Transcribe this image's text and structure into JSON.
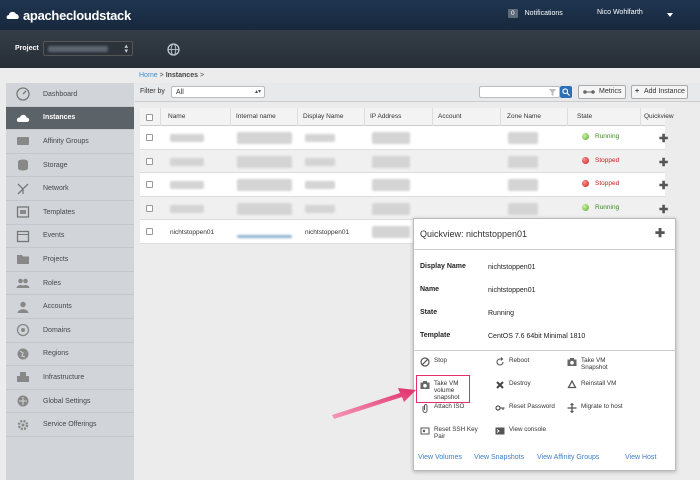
{
  "app": {
    "name": "apachecloudstack"
  },
  "header": {
    "notifications_count": "0",
    "notifications_label": "Notifications",
    "user_name": "Nico Wohlfarth"
  },
  "project": {
    "label": "Project"
  },
  "sidebar": {
    "items": [
      {
        "label": "Dashboard",
        "icon": "dashboard-icon"
      },
      {
        "label": "Instances",
        "icon": "cloud-icon"
      },
      {
        "label": "Affinity Groups",
        "icon": "affinity-icon"
      },
      {
        "label": "Storage",
        "icon": "storage-icon"
      },
      {
        "label": "Network",
        "icon": "network-icon"
      },
      {
        "label": "Templates",
        "icon": "templates-icon"
      },
      {
        "label": "Events",
        "icon": "events-icon"
      },
      {
        "label": "Projects",
        "icon": "folder-icon"
      },
      {
        "label": "Roles",
        "icon": "roles-icon"
      },
      {
        "label": "Accounts",
        "icon": "accounts-icon"
      },
      {
        "label": "Domains",
        "icon": "domains-icon"
      },
      {
        "label": "Regions",
        "icon": "globe-icon"
      },
      {
        "label": "Infrastructure",
        "icon": "infrastructure-icon"
      },
      {
        "label": "Global Settings",
        "icon": "settings-icon"
      },
      {
        "label": "Service Offerings",
        "icon": "gear-icon"
      }
    ],
    "active": "Instances"
  },
  "breadcrumb": {
    "home": "Home",
    "sep": ">",
    "current": "Instances"
  },
  "toolbar": {
    "filter_label": "Filter by",
    "filter_value": "All",
    "metrics_label": "Metrics",
    "add_label": "Add Instance"
  },
  "table": {
    "columns": [
      "Name",
      "Internal name",
      "Display Name",
      "IP Address",
      "Account",
      "Zone Name",
      "State",
      "Quickview"
    ],
    "rows": [
      {
        "state": "Running",
        "status": "green"
      },
      {
        "state": "Stopped",
        "status": "red"
      },
      {
        "state": "Stopped",
        "status": "red"
      },
      {
        "state": "Running",
        "status": "green"
      },
      {
        "name": "nichtstoppen01",
        "display_name": "nichtstoppen01"
      }
    ]
  },
  "quickview": {
    "title": "Quickview: nichtstoppen01",
    "fields": [
      {
        "label": "Display Name",
        "value": "nichtstoppen01"
      },
      {
        "label": "Name",
        "value": "nichtstoppen01"
      },
      {
        "label": "State",
        "value": "Running"
      },
      {
        "label": "Template",
        "value": "CentOS 7.6 64bit Minimal 1810"
      }
    ],
    "actions": [
      {
        "label": "Stop",
        "icon": "stop-icon"
      },
      {
        "label": "Reboot",
        "icon": "reboot-icon"
      },
      {
        "label": "Take VM Snapshot",
        "icon": "camera-icon"
      },
      {
        "label": "Take VM volume snapshot",
        "icon": "camera-icon"
      },
      {
        "label": "Destroy",
        "icon": "destroy-icon"
      },
      {
        "label": "Reinstall VM",
        "icon": "recycle-icon"
      },
      {
        "label": "Attach ISO",
        "icon": "paperclip-icon"
      },
      {
        "label": "Reset Password",
        "icon": "key-icon"
      },
      {
        "label": "Migrate to host",
        "icon": "migrate-icon"
      },
      {
        "label": "Reset SSH Key Pair",
        "icon": "key-pair-icon"
      },
      {
        "label": "View console",
        "icon": "console-icon"
      }
    ],
    "links": [
      "View Volumes",
      "View Snapshots",
      "View Affinity Groups",
      "View Host"
    ]
  },
  "colors": {
    "topbar": "#1f3550",
    "accent": "#3d8fd6",
    "highlight": "#e0306b",
    "running": "#5fa82a",
    "stopped": "#c31d1d"
  }
}
